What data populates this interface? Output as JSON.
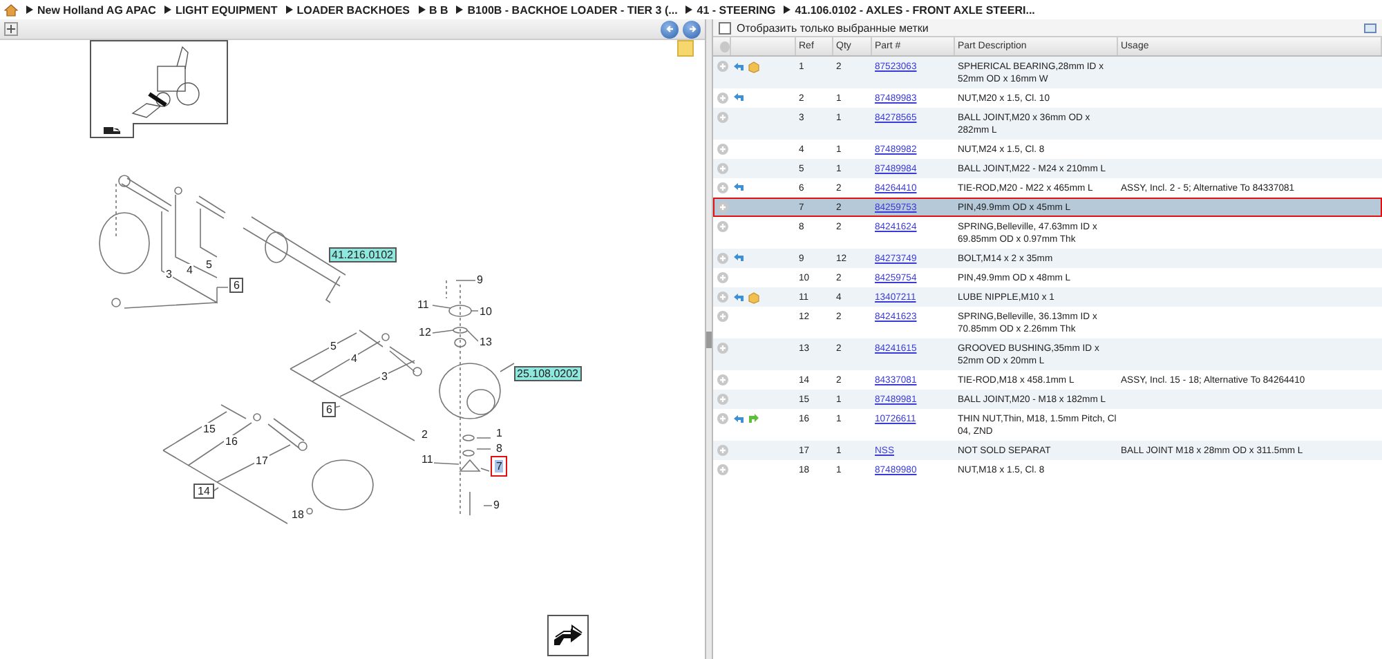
{
  "breadcrumb": [
    "New Holland AG APAC",
    "LIGHT EQUIPMENT",
    "LOADER BACKHOES",
    "B B",
    "B100B - BACKHOE LOADER - TIER 3 (...",
    "41 - STEERING",
    "41.106.0102 - AXLES - FRONT AXLE STEERI..."
  ],
  "diagram": {
    "callouts": [
      {
        "label": "3",
        "kind": "number",
        "selected": false
      },
      {
        "label": "4",
        "kind": "number",
        "selected": false
      },
      {
        "label": "5",
        "kind": "number",
        "selected": false
      },
      {
        "label": "6",
        "kind": "box",
        "selected": false
      },
      {
        "label": "41.216.0102",
        "kind": "link",
        "selected": false
      },
      {
        "label": "9",
        "kind": "number",
        "selected": false
      },
      {
        "label": "11",
        "kind": "number",
        "selected": false
      },
      {
        "label": "10",
        "kind": "number",
        "selected": false
      },
      {
        "label": "12",
        "kind": "number",
        "selected": false
      },
      {
        "label": "13",
        "kind": "number",
        "selected": false
      },
      {
        "label": "5",
        "kind": "number",
        "selected": false
      },
      {
        "label": "4",
        "kind": "number",
        "selected": false
      },
      {
        "label": "3",
        "kind": "number",
        "selected": false
      },
      {
        "label": "25.108.0202",
        "kind": "link",
        "selected": false
      },
      {
        "label": "6",
        "kind": "box",
        "selected": false
      },
      {
        "label": "2",
        "kind": "number",
        "selected": false
      },
      {
        "label": "1",
        "kind": "number",
        "selected": false
      },
      {
        "label": "8",
        "kind": "number",
        "selected": false
      },
      {
        "label": "11",
        "kind": "number",
        "selected": false
      },
      {
        "label": "7",
        "kind": "number",
        "selected": true
      },
      {
        "label": "9",
        "kind": "number",
        "selected": false
      },
      {
        "label": "15",
        "kind": "number",
        "selected": false
      },
      {
        "label": "16",
        "kind": "number",
        "selected": false
      },
      {
        "label": "17",
        "kind": "number",
        "selected": false
      },
      {
        "label": "14",
        "kind": "box",
        "selected": false
      },
      {
        "label": "18",
        "kind": "number",
        "selected": false
      }
    ]
  },
  "filter": {
    "label": "Отобразить только выбранные метки",
    "checked": false
  },
  "table": {
    "columns": [
      "Ref",
      "Qty",
      "Part #",
      "Part Description",
      "Usage"
    ],
    "rows": [
      {
        "ref": "1",
        "qty": "2",
        "part": "87523063",
        "description": "SPHERICAL BEARING,28mm ID x 52mm OD x 16mm W",
        "has_return": true,
        "has_package": true,
        "has_forward": false,
        "selected": false
      },
      {
        "ref": "2",
        "qty": "1",
        "part": "87489983",
        "description": "NUT,M20 x 1.5, Cl. 10",
        "has_return": true,
        "has_package": false,
        "has_forward": false,
        "selected": false
      },
      {
        "ref": "3",
        "qty": "1",
        "part": "84278565",
        "description": "BALL JOINT,M20 x 36mm OD x 282mm L",
        "has_return": false,
        "has_package": false,
        "has_forward": false,
        "selected": false
      },
      {
        "ref": "4",
        "qty": "1",
        "part": "87489982",
        "description": "NUT,M24 x 1.5, Cl. 8",
        "has_return": false,
        "has_package": false,
        "has_forward": false,
        "selected": false
      },
      {
        "ref": "5",
        "qty": "1",
        "part": "87489984",
        "description": "BALL JOINT,M22 - M24 x 210mm L",
        "has_return": false,
        "has_package": false,
        "has_forward": false,
        "selected": false
      },
      {
        "ref": "6",
        "qty": "2",
        "part": "84264410",
        "description": "TIE-ROD,M20 - M22 x 465mm L",
        "usage": "ASSY, Incl. 2 - 5; Alternative To 84337081",
        "has_return": true,
        "has_package": false,
        "has_forward": false,
        "selected": false
      },
      {
        "ref": "7",
        "qty": "2",
        "part": "84259753",
        "description": "PIN,49.9mm OD x 45mm L",
        "has_return": false,
        "has_package": false,
        "has_forward": false,
        "selected": true
      },
      {
        "ref": "8",
        "qty": "2",
        "part": "84241624",
        "description": "SPRING,Belleville, 47.63mm ID x 69.85mm OD x 0.97mm Thk",
        "has_return": false,
        "has_package": false,
        "has_forward": false,
        "selected": false
      },
      {
        "ref": "9",
        "qty": "12",
        "part": "84273749",
        "description": "BOLT,M14 x 2 x 35mm",
        "has_return": true,
        "has_package": false,
        "has_forward": false,
        "selected": false
      },
      {
        "ref": "10",
        "qty": "2",
        "part": "84259754",
        "description": "PIN,49.9mm OD x 48mm L",
        "has_return": false,
        "has_package": false,
        "has_forward": false,
        "selected": false
      },
      {
        "ref": "11",
        "qty": "4",
        "part": "13407211",
        "description": "LUBE NIPPLE,M10 x 1",
        "has_return": true,
        "has_package": true,
        "has_forward": false,
        "selected": false
      },
      {
        "ref": "12",
        "qty": "2",
        "part": "84241623",
        "description": "SPRING,Belleville, 36.13mm ID x 70.85mm OD x 2.26mm Thk",
        "has_return": false,
        "has_package": false,
        "has_forward": false,
        "selected": false
      },
      {
        "ref": "13",
        "qty": "2",
        "part": "84241615",
        "description": "GROOVED BUSHING,35mm ID x 52mm OD x 20mm L",
        "has_return": false,
        "has_package": false,
        "has_forward": false,
        "selected": false
      },
      {
        "ref": "14",
        "qty": "2",
        "part": "84337081",
        "description": "TIE-ROD,M18 x 458.1mm L",
        "usage": "ASSY, Incl. 15 - 18; Alternative To 84264410",
        "has_return": false,
        "has_package": false,
        "has_forward": false,
        "selected": false
      },
      {
        "ref": "15",
        "qty": "1",
        "part": "87489981",
        "description": "BALL JOINT,M20 - M18 x 182mm L",
        "has_return": false,
        "has_package": false,
        "has_forward": false,
        "selected": false
      },
      {
        "ref": "16",
        "qty": "1",
        "part": "10726611",
        "description": "THIN NUT,Thin, M18, 1.5mm Pitch, Cl 04, ZND",
        "has_return": true,
        "has_package": false,
        "has_forward": true,
        "selected": false
      },
      {
        "ref": "17",
        "qty": "1",
        "part": "NSS",
        "description": "NOT SOLD SEPARAT",
        "usage": "BALL JOINT M18 x 28mm OD x 311.5mm L",
        "has_return": false,
        "has_package": false,
        "has_forward": false,
        "selected": false
      },
      {
        "ref": "18",
        "qty": "1",
        "part": "87489980",
        "description": "NUT,M18 x 1.5, Cl. 8",
        "has_return": false,
        "has_package": false,
        "has_forward": false,
        "selected": false
      }
    ]
  }
}
